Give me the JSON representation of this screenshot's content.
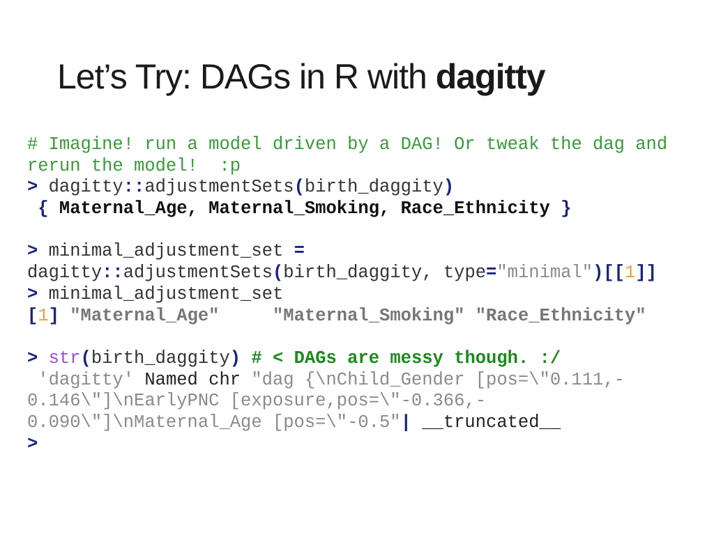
{
  "slide": {
    "title_regular": "Let’s Try: DAGs in R with ",
    "title_bold": "dagitty"
  },
  "code_lines": [
    [
      {
        "t": "comment",
        "v": "# Imagine! run a model driven by a DAG! Or tweak the dag and"
      }
    ],
    [
      {
        "t": "comment",
        "v": "rerun the model!  :p"
      }
    ],
    [
      {
        "t": "prompt",
        "v": "> "
      },
      {
        "t": "plain",
        "v": "dagitty"
      },
      {
        "t": "punct",
        "v": "::"
      },
      {
        "t": "plain",
        "v": "adjustmentSets"
      },
      {
        "t": "punct",
        "v": "("
      },
      {
        "t": "plain",
        "v": "birth_daggity"
      },
      {
        "t": "punct",
        "v": ")"
      }
    ],
    [
      {
        "t": "plain",
        "v": " "
      },
      {
        "t": "punct",
        "v": "{"
      },
      {
        "t": "out-bold",
        "v": " Maternal_Age, Maternal_Smoking, Race_Ethnicity "
      },
      {
        "t": "punct",
        "v": "}"
      }
    ],
    [
      {
        "t": "plain",
        "v": " "
      }
    ],
    [
      {
        "t": "prompt",
        "v": "> "
      },
      {
        "t": "plain",
        "v": "minimal_adjustment_set "
      },
      {
        "t": "punct",
        "v": "="
      }
    ],
    [
      {
        "t": "plain",
        "v": "dagitty"
      },
      {
        "t": "punct",
        "v": "::"
      },
      {
        "t": "plain",
        "v": "adjustmentSets"
      },
      {
        "t": "punct",
        "v": "("
      },
      {
        "t": "plain",
        "v": "birth_daggity, type"
      },
      {
        "t": "punct",
        "v": "="
      },
      {
        "t": "string",
        "v": "\"minimal\""
      },
      {
        "t": "punct",
        "v": ")[["
      },
      {
        "t": "number",
        "v": "1"
      },
      {
        "t": "punct",
        "v": "]]"
      }
    ],
    [
      {
        "t": "prompt",
        "v": "> "
      },
      {
        "t": "plain",
        "v": "minimal_adjustment_set"
      }
    ],
    [
      {
        "t": "punct",
        "v": "["
      },
      {
        "t": "number",
        "v": "1"
      },
      {
        "t": "punct",
        "v": "]"
      },
      {
        "t": "plain",
        "v": " "
      },
      {
        "t": "string-bold",
        "v": "\"Maternal_Age\"     \"Maternal_Smoking\" \"Race_Ethnicity\""
      }
    ],
    [
      {
        "t": "plain",
        "v": " "
      }
    ],
    [
      {
        "t": "prompt",
        "v": "> "
      },
      {
        "t": "func",
        "v": "str"
      },
      {
        "t": "punct",
        "v": "("
      },
      {
        "t": "plain",
        "v": "birth_daggity"
      },
      {
        "t": "punct",
        "v": ")"
      },
      {
        "t": "plain",
        "v": " "
      },
      {
        "t": "comment-bold",
        "v": "# < DAGs are messy though. :/"
      }
    ],
    [
      {
        "t": "string",
        "v": " 'dagitty'"
      },
      {
        "t": "dark",
        "v": " Named chr "
      },
      {
        "t": "string",
        "v": "\"dag {\\nChild_Gender [pos=\\\"0.111,-"
      }
    ],
    [
      {
        "t": "string",
        "v": "0.146\\\"]\\nEarlyPNC [exposure,pos=\\\"-0.366,-"
      }
    ],
    [
      {
        "t": "string",
        "v": "0.090\\\"]\\nMaternal_Age [pos=\\\"-0.5\""
      },
      {
        "t": "punct",
        "v": "|"
      },
      {
        "t": "dark",
        "v": " __truncated__"
      }
    ],
    [
      {
        "t": "prompt",
        "v": ">"
      }
    ]
  ]
}
